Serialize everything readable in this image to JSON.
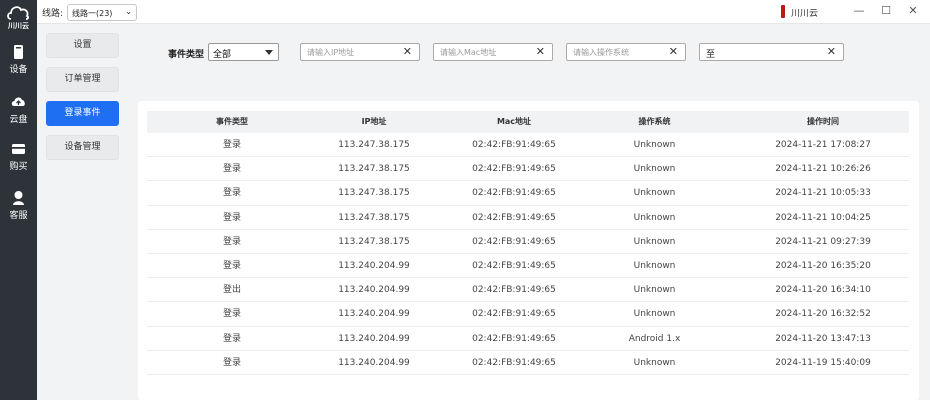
{
  "app": {
    "logo_text": "川川云",
    "title": "川川云"
  },
  "topbar": {
    "route_label": "线路:",
    "route_value": "线路一(23)",
    "route_icon": "chevron-down-icon"
  },
  "window": {
    "minimize": "—",
    "maximize": "☐",
    "close": "✕"
  },
  "sidebar": {
    "items": [
      {
        "label": "设备",
        "icon": "phone-icon"
      },
      {
        "label": "云盘",
        "icon": "cloud-upload-icon"
      },
      {
        "label": "购买",
        "icon": "card-icon"
      },
      {
        "label": "客服",
        "icon": "headset-icon"
      }
    ]
  },
  "submenu": {
    "items": [
      {
        "label": "设置",
        "active": false
      },
      {
        "label": "订单管理",
        "active": false
      },
      {
        "label": "登录事件",
        "active": true
      },
      {
        "label": "设备管理",
        "active": false
      }
    ]
  },
  "filters": {
    "event_type_label": "事件类型",
    "event_type_value": "全部",
    "ip_placeholder": "请输入IP地址",
    "mac_placeholder": "请输入Mac地址",
    "os_placeholder": "请输入操作系统",
    "date_value": "至",
    "clear": "✕"
  },
  "table": {
    "headers": [
      "事件类型",
      "IP地址",
      "Mac地址",
      "操作系统",
      "操作时间"
    ],
    "rows": [
      [
        "登录",
        "113.247.38.175",
        "02:42:FB:91:49:65",
        "Unknown",
        "2024-11-21 17:08:27"
      ],
      [
        "登录",
        "113.247.38.175",
        "02:42:FB:91:49:65",
        "Unknown",
        "2024-11-21 10:26:26"
      ],
      [
        "登录",
        "113.247.38.175",
        "02:42:FB:91:49:65",
        "Unknown",
        "2024-11-21 10:05:33"
      ],
      [
        "登录",
        "113.247.38.175",
        "02:42:FB:91:49:65",
        "Unknown",
        "2024-11-21 10:04:25"
      ],
      [
        "登录",
        "113.247.38.175",
        "02:42:FB:91:49:65",
        "Unknown",
        "2024-11-21 09:27:39"
      ],
      [
        "登录",
        "113.240.204.99",
        "02:42:FB:91:49:65",
        "Unknown",
        "2024-11-20 16:35:20"
      ],
      [
        "登出",
        "113.240.204.99",
        "02:42:FB:91:49:65",
        "Unknown",
        "2024-11-20 16:34:10"
      ],
      [
        "登录",
        "113.240.204.99",
        "02:42:FB:91:49:65",
        "Unknown",
        "2024-11-20 16:32:52"
      ],
      [
        "登录",
        "113.240.204.99",
        "02:42:FB:91:49:65",
        "Android 1.x",
        "2024-11-20 13:47:13"
      ],
      [
        "登录",
        "113.240.204.99",
        "02:42:FB:91:49:65",
        "Unknown",
        "2024-11-19 15:40:09"
      ]
    ]
  }
}
